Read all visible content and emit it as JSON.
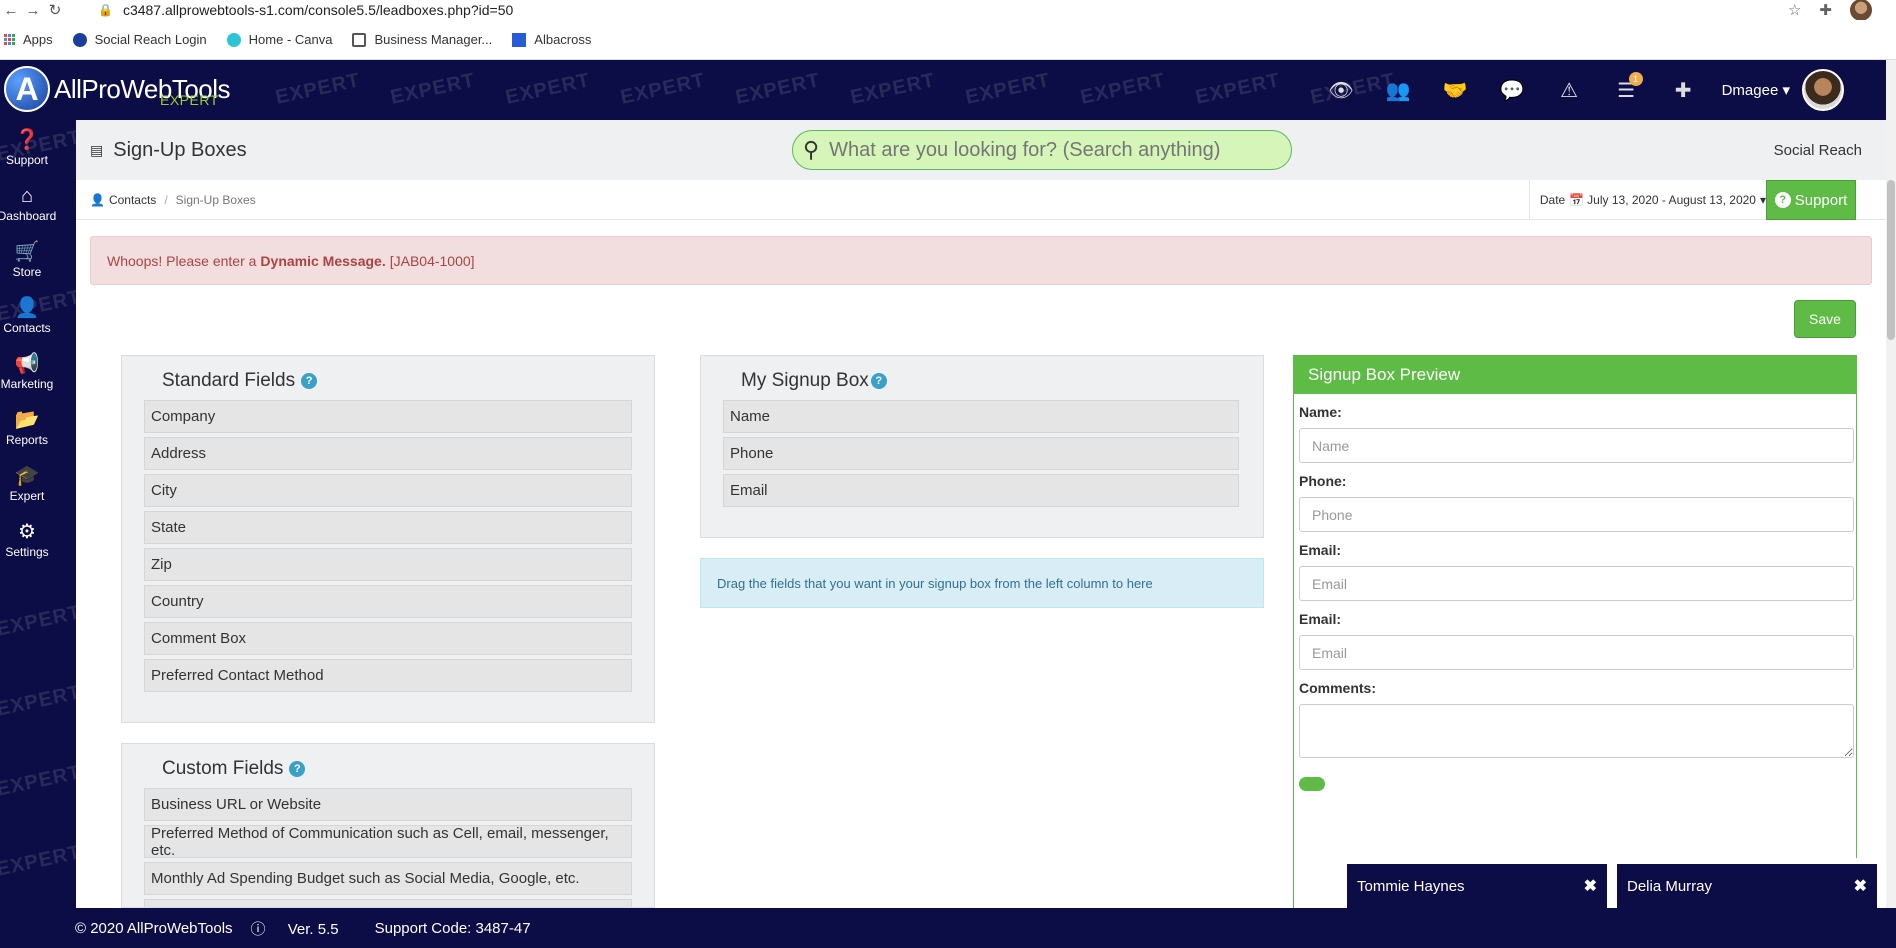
{
  "browser": {
    "url": "c3487.allprowebtools-s1.com/console5.5/leadboxes.php?id=50",
    "bookmarks": [
      "Apps",
      "Social Reach Login",
      "Home - Canva",
      "Business Manager...",
      "Albacross"
    ]
  },
  "header": {
    "logo_text": "AllProWebTools",
    "logo_sub": "EXPERT",
    "watermark": "EXPERT",
    "icons": [
      "eye-icon",
      "users-icon",
      "handshake-icon",
      "comments-icon",
      "warning-icon",
      "tasks-icon",
      "plus-icon"
    ],
    "task_badge": "1",
    "username": "Dmagee"
  },
  "sidebar": {
    "items": [
      {
        "label": "Support",
        "icon": "question-circle-icon"
      },
      {
        "label": "Dashboard",
        "icon": "home-icon"
      },
      {
        "label": "Store",
        "icon": "cart-icon"
      },
      {
        "label": "Contacts",
        "icon": "user-icon"
      },
      {
        "label": "Marketing",
        "icon": "megaphone-icon"
      },
      {
        "label": "Reports",
        "icon": "folder-icon"
      },
      {
        "label": "Expert",
        "icon": "graduation-cap-icon"
      },
      {
        "label": "Settings",
        "icon": "gear-icon"
      }
    ]
  },
  "page": {
    "title": "Sign-Up Boxes",
    "search_placeholder": "What are you looking for? (Search anything)",
    "org_name": "Social Reach",
    "breadcrumb": [
      "Contacts",
      "Sign-Up Boxes"
    ],
    "date_label": "Date",
    "date_range": "July 13, 2020 - August 13, 2020",
    "support_label": "Support",
    "save_label": "Save"
  },
  "alert": {
    "prefix": "Whoops! Please enter a",
    "bold": "Dynamic Message.",
    "code": "[JAB04-1000]"
  },
  "standard_fields": {
    "title": "Standard Fields",
    "items": [
      "Company",
      "Address",
      "City",
      "State",
      "Zip",
      "Country",
      "Comment Box",
      "Preferred Contact Method"
    ]
  },
  "custom_fields": {
    "title": "Custom Fields",
    "items": [
      "Business URL or Website",
      "Preferred Method of Communication such as Cell, email, messenger, etc.",
      "Monthly Ad Spending Budget such as Social Media, Google, etc.",
      ""
    ]
  },
  "my_signup_box": {
    "title": "My Signup Box",
    "items": [
      "Name",
      "Phone",
      "Email"
    ],
    "hint": "Drag the fields that you want in your signup box from the left column to here"
  },
  "preview": {
    "title": "Signup Box Preview",
    "fields": [
      {
        "label": "Name:",
        "placeholder": "Name"
      },
      {
        "label": "Phone:",
        "placeholder": "Phone"
      },
      {
        "label": "Email:",
        "placeholder": "Email"
      },
      {
        "label": "Email:",
        "placeholder": "Email"
      }
    ],
    "comments_label": "Comments:"
  },
  "chats": [
    {
      "name": "Tommie Haynes"
    },
    {
      "name": "Delia Murray"
    }
  ],
  "footer": {
    "copyright": "© 2020 AllProWebTools",
    "version": "Ver. 5.5",
    "support_code": "Support Code: 3487-47"
  }
}
